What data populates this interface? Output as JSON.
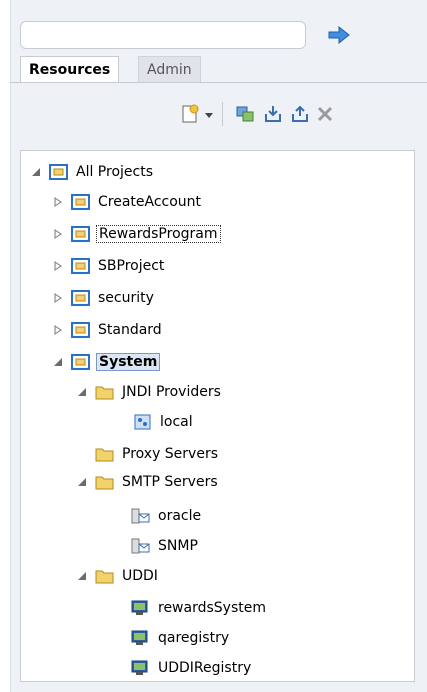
{
  "search": {
    "placeholder": ""
  },
  "tabs": [
    {
      "label": "Resources"
    },
    {
      "label": "Admin"
    }
  ],
  "toolbar": {
    "icons": [
      "new-icon",
      "dropdown-icon",
      "refresh-icon",
      "import-icon",
      "export-icon",
      "delete-icon"
    ]
  },
  "tree": {
    "root": "All Projects",
    "projects": [
      "CreateAccount",
      "RewardsProgram",
      "SBProject",
      "security",
      "Standard"
    ],
    "system": "System",
    "jndi": "JNDI Providers",
    "local": "local",
    "proxy": "Proxy Servers",
    "smtp": "SMTP Servers",
    "oracle": "oracle",
    "snmp": "SNMP",
    "uddi": "UDDI",
    "uddi_items": [
      "rewardsSystem",
      "qaregistry",
      "UDDIRegistry"
    ]
  },
  "colors": {
    "accent": "#2a6fc9",
    "selection": "#dce6f4",
    "folder": "#f2d36b"
  }
}
